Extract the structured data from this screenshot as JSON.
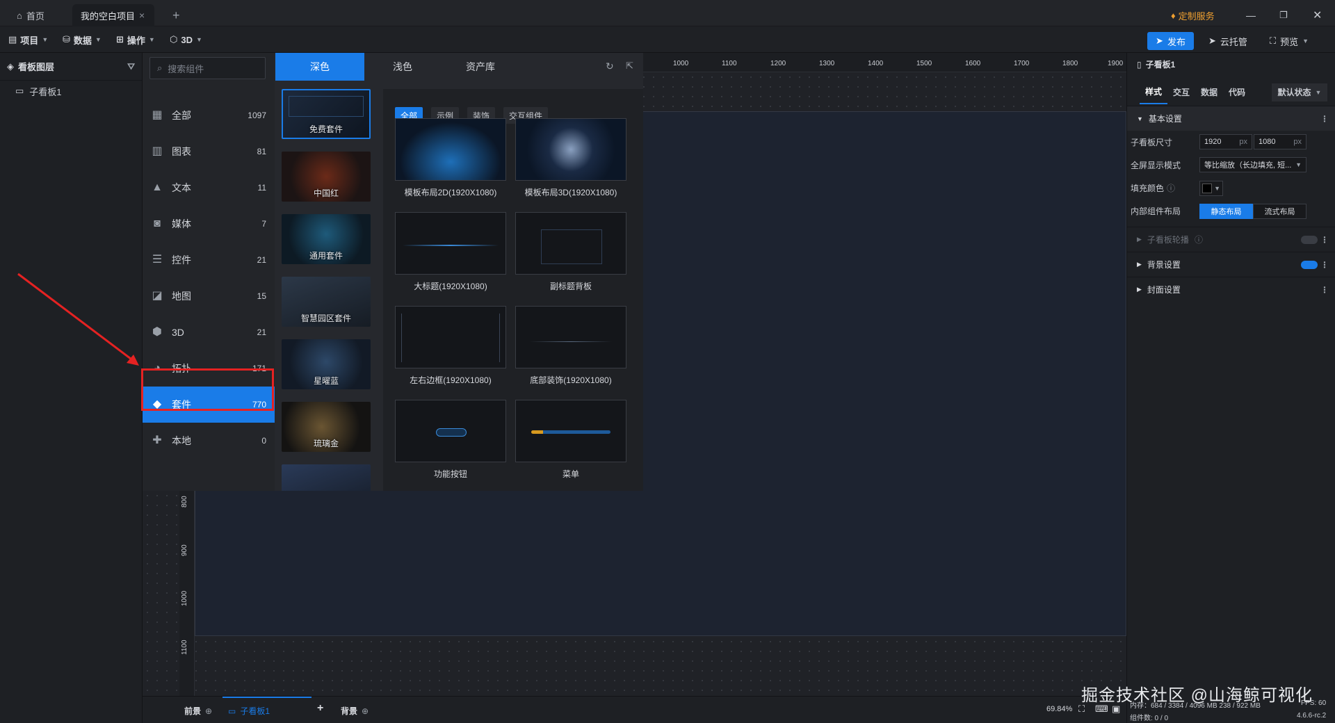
{
  "tabs": {
    "home": "首页",
    "project": "我的空白项目",
    "new_tab": "+",
    "custom_service": "定制服务"
  },
  "menu": {
    "items": [
      "项目",
      "数据",
      "操作",
      "3D"
    ],
    "publish": "发布",
    "cloud": "云托管",
    "preview": "预览"
  },
  "layers": {
    "title": "看板图层",
    "items": [
      "子看板1"
    ]
  },
  "components": {
    "search_placeholder": "搜索组件",
    "theme_tabs": [
      "深色",
      "浅色",
      "资产库"
    ],
    "categories": [
      {
        "label": "全部",
        "count": "1097",
        "icon": "grid-icon"
      },
      {
        "label": "图表",
        "count": "81",
        "icon": "bar-chart-icon"
      },
      {
        "label": "文本",
        "count": "11",
        "icon": "text-icon"
      },
      {
        "label": "媒体",
        "count": "7",
        "icon": "media-icon"
      },
      {
        "label": "控件",
        "count": "21",
        "icon": "control-icon"
      },
      {
        "label": "地图",
        "count": "15",
        "icon": "map-icon"
      },
      {
        "label": "3D",
        "count": "21",
        "icon": "cube-icon"
      },
      {
        "label": "拓扑",
        "count": "171",
        "icon": "topology-icon"
      },
      {
        "label": "套件",
        "count": "770",
        "icon": "kit-icon"
      },
      {
        "label": "本地",
        "count": "0",
        "icon": "puzzle-icon"
      }
    ],
    "kits": [
      "免费套件",
      "中国红",
      "通用套件",
      "智慧园区套件",
      "星曜蓝",
      "琉璃金"
    ],
    "sub_tabs": [
      "全部",
      "示例",
      "装饰",
      "交互组件"
    ],
    "templates": [
      "模板布局2D(1920X1080)",
      "模板布局3D(1920X1080)",
      "大标题(1920X1080)",
      "副标题背板",
      "左右边框(1920X1080)",
      "底部装饰(1920X1080)",
      "功能按钮",
      "菜单"
    ]
  },
  "ruler": {
    "top": [
      "1000",
      "1100",
      "1200",
      "1300",
      "1400",
      "1500",
      "1600",
      "1700",
      "1800",
      "1900"
    ],
    "left": [
      "800",
      "900",
      "1000",
      "1100"
    ]
  },
  "bottom": {
    "foreground": "前景",
    "board": "子看板1",
    "add": "+",
    "background": "背景",
    "zoom": "69.84%",
    "status": "内存：684 / 3384 / 4096 MB 238 / 922 MB",
    "fps": "FPS: 60",
    "count": "组件数: 0 / 0",
    "version": "4.6.6-rc.2"
  },
  "properties": {
    "title": "子看板1",
    "tabs": [
      "样式",
      "交互",
      "数据",
      "代码"
    ],
    "state": "默认状态",
    "basic": "基本设置",
    "size_label": "子看板尺寸",
    "width": "1920",
    "height": "1080",
    "unit": "px",
    "fullscreen_label": "全屏显示模式",
    "fullscreen_value": "等比缩放（长边填充, 短...",
    "fill_label": "填充颜色",
    "layout_label": "内部组件布局",
    "layout_static": "静态布局",
    "layout_flow": "流式布局",
    "carousel": "子看板轮播",
    "bg_settings": "背景设置",
    "cover_settings": "封面设置"
  },
  "watermark": "掘金技术社区 @山海鲸可视化",
  "colors": {
    "accent": "#1a7ce8",
    "highlight": "#e52222"
  }
}
